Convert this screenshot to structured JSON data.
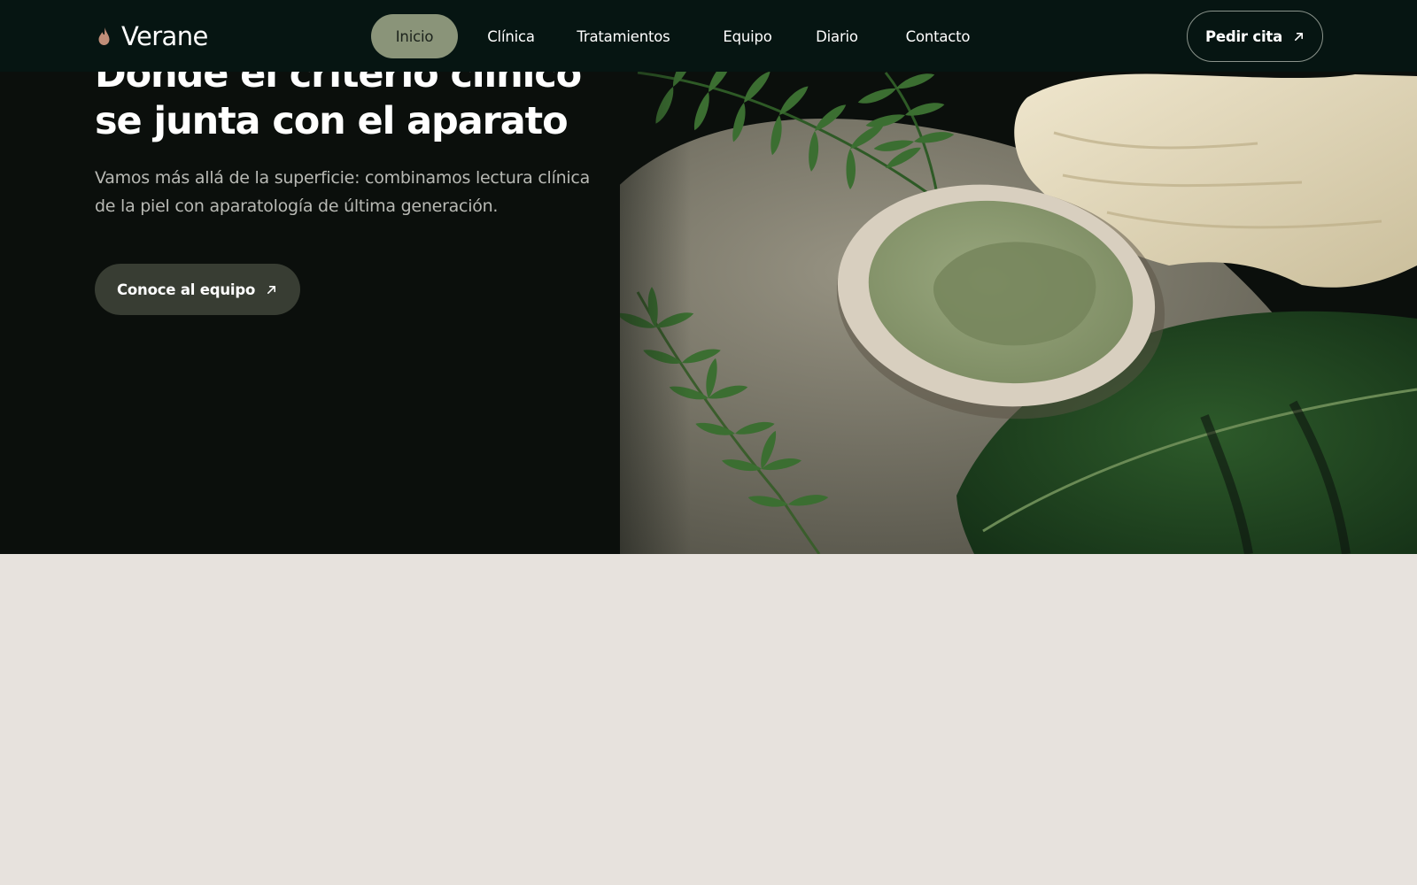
{
  "brand": {
    "name": "Verane",
    "icon": "drop-icon",
    "icon_color": "#c08e78"
  },
  "nav": {
    "items": [
      {
        "label": "Inicio",
        "active": true
      },
      {
        "label": "Clínica",
        "active": false
      },
      {
        "label": "Tratamientos",
        "active": false
      },
      {
        "label": "Equipo",
        "active": false
      },
      {
        "label": "Diario",
        "active": false
      },
      {
        "label": "Contacto",
        "active": false
      }
    ],
    "active_color": "#8a9479"
  },
  "header": {
    "book_label": "Pedir cita",
    "book_icon": "arrow-up-right-icon"
  },
  "hero": {
    "title_lines": [
      "Donde el criterio clínico",
      "se junta con el aparato"
    ],
    "subtitle_lines": [
      "Vamos más allá de la superficie: combinamos lectura clínica",
      "de la piel con aparatología de última generación."
    ],
    "cta_label": "Conoce al equipo",
    "cta_icon": "arrow-up-right-icon"
  },
  "colors": {
    "header_bg": "#061512",
    "hero_bg": "#0b0f0c",
    "page_bg": "#e7e2dd",
    "cta_bg": "#383d33"
  }
}
